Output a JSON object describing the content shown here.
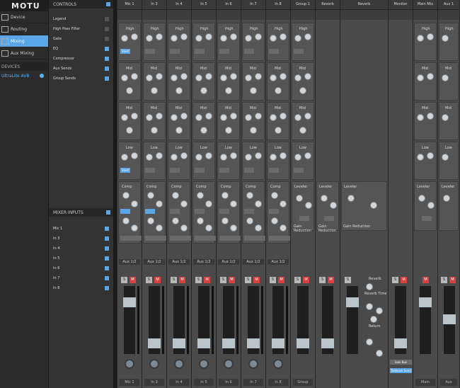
{
  "sidebar": {
    "logo": "MOTU",
    "nav": [
      {
        "label": "Device"
      },
      {
        "label": "Routing"
      },
      {
        "label": "Mixing"
      },
      {
        "label": "Aux Mixing"
      }
    ],
    "devices_header": "DEVICES",
    "device": "UltraLite AVB"
  },
  "controls_panel": {
    "header": "CONTROLS",
    "items": [
      {
        "label": "Legend"
      },
      {
        "label": "High Pass Filter"
      },
      {
        "label": "Gate"
      },
      {
        "label": "EQ"
      },
      {
        "label": "Compressor"
      },
      {
        "label": "Aux Sends"
      },
      {
        "label": "Group Sends"
      }
    ],
    "mixer_inputs_header": "MIXER INPUTS",
    "inputs": [
      {
        "label": "Mic 1"
      },
      {
        "label": "In 3"
      },
      {
        "label": "In 4"
      },
      {
        "label": "In 5"
      },
      {
        "label": "In 6"
      },
      {
        "label": "In 7"
      },
      {
        "label": "In 8"
      }
    ]
  },
  "channels": [
    {
      "name": "Mic 1",
      "bottom": "Mic 1"
    },
    {
      "name": "In 3",
      "bottom": "In 3"
    },
    {
      "name": "In 4",
      "bottom": "In 4"
    },
    {
      "name": "In 5",
      "bottom": "In 5"
    },
    {
      "name": "In 6",
      "bottom": "In 6"
    },
    {
      "name": "In 7",
      "bottom": "In 7"
    },
    {
      "name": "In 8",
      "bottom": "In 8"
    }
  ],
  "group": {
    "name": "Group 1",
    "bottom": "Group"
  },
  "reverb": {
    "name": "Reverb",
    "labels": [
      "Reverb",
      "Reverb Time",
      "Send",
      "Predelay",
      "Return",
      "Send",
      "Return"
    ]
  },
  "monitor": {
    "name": "Monitor",
    "buttons": [
      "Solo Bus",
      "Talkback Send"
    ]
  },
  "mainmix": {
    "name": "Main Mix",
    "bottom": "Main"
  },
  "aux": {
    "name": "Aux 1",
    "bottom": "Aux"
  },
  "labels": {
    "high": "High",
    "gain": "Gain",
    "freq": "Freq",
    "mid": "Mid",
    "low": "Low",
    "shelf": "Shelf",
    "comp": "Comp",
    "thresh": "Thresh",
    "ratio": "Ratio",
    "attack": "Attack",
    "release": "Release",
    "gainred": "Gain Reduction",
    "leveler": "Leveler",
    "makeup": "Makeup",
    "reduction": "Reduction",
    "aux": "Aux 1/2",
    "solo": "S",
    "mute": "M",
    "pan": "C"
  }
}
